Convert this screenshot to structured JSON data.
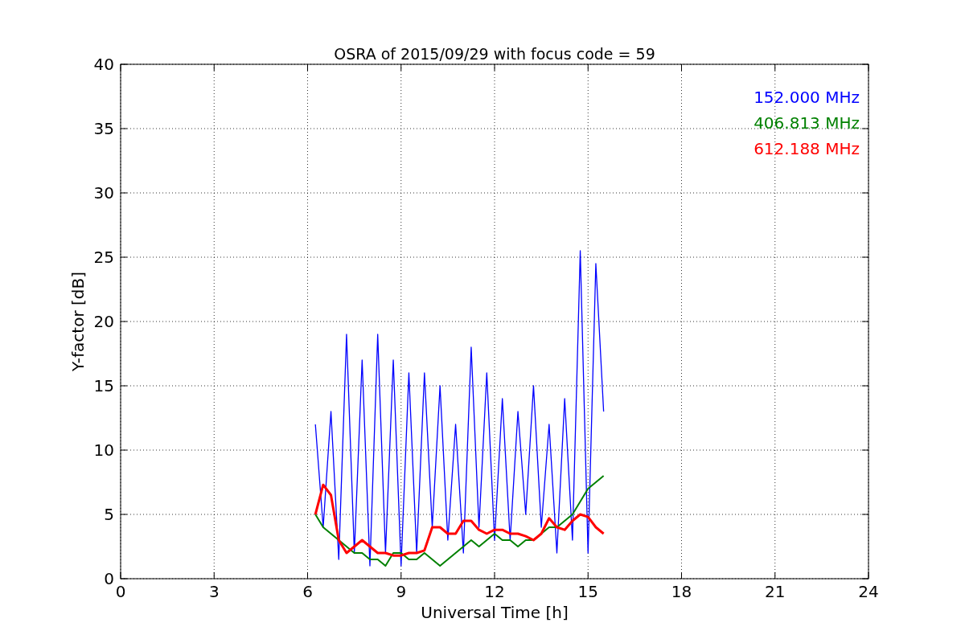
{
  "chart_data": {
    "type": "line",
    "title": "OSRA of 2015/09/29 with focus code = 59",
    "xlabel": "Universal Time [h]",
    "ylabel": "Y-factor [dB]",
    "x": [
      6.25,
      6.5,
      6.75,
      7,
      7.25,
      7.5,
      7.75,
      8,
      8.25,
      8.5,
      8.75,
      9,
      9.25,
      9.5,
      9.75,
      10,
      10.25,
      10.5,
      10.75,
      11,
      11.25,
      11.5,
      11.75,
      12,
      12.25,
      12.5,
      12.75,
      13,
      13.25,
      13.5,
      13.75,
      14,
      14.25,
      14.5,
      14.75,
      15,
      15.25,
      15.5
    ],
    "series": [
      {
        "name": "152.000 MHz",
        "color": "#0000ff",
        "values": [
          12,
          4,
          13,
          1.5,
          19,
          2,
          17,
          1,
          19,
          2,
          17,
          1,
          16,
          2,
          16,
          4,
          15,
          3,
          12,
          2,
          18,
          4,
          16,
          3,
          14,
          3,
          13,
          5,
          15,
          4,
          12,
          2,
          14,
          3,
          25.5,
          2,
          24.5,
          13
        ]
      },
      {
        "name": "406.813 MHz",
        "color": "#008000",
        "values": [
          5,
          4,
          3.5,
          3,
          2.5,
          2,
          2,
          1.5,
          1.5,
          1,
          2,
          2,
          1.5,
          1.5,
          2,
          1.5,
          1,
          1.5,
          2,
          2.5,
          3,
          2.5,
          3,
          3.5,
          3,
          3,
          2.5,
          3,
          3,
          3.5,
          4,
          4,
          4.5,
          5,
          6,
          7,
          7.5,
          8
        ]
      },
      {
        "name": "612.188 MHz",
        "color": "#ff0000",
        "values": [
          5,
          7.3,
          6.5,
          3,
          2,
          2.5,
          3,
          2.5,
          2,
          2,
          1.8,
          1.8,
          2,
          2,
          2.2,
          4,
          4,
          3.5,
          3.5,
          4.5,
          4.5,
          3.8,
          3.5,
          3.8,
          3.8,
          3.5,
          3.5,
          3.3,
          3,
          3.5,
          4.7,
          4,
          3.8,
          4.5,
          5,
          4.8,
          4,
          3.5
        ]
      }
    ],
    "grid": true,
    "xlim": [
      0,
      24
    ],
    "ylim": [
      0,
      40
    ],
    "xticks": [
      0,
      3,
      6,
      9,
      12,
      15,
      18,
      21,
      24
    ],
    "yticks": [
      0,
      5,
      10,
      15,
      20,
      25,
      30,
      35,
      40
    ]
  }
}
